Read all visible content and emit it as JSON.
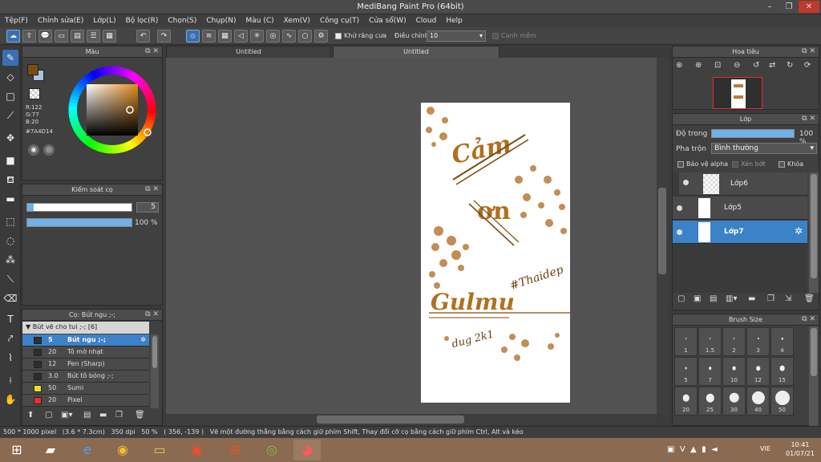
{
  "window": {
    "title": "MediBang Paint Pro (64bit)",
    "min": "–",
    "max": "❐",
    "close": "✕"
  },
  "menu": [
    "Tệp(F)",
    "Chỉnh sửa(E)",
    "Lớp(L)",
    "Bộ lọc(R)",
    "Chọn(S)",
    "Chụp(N)",
    "Màu (C)",
    "Xem(V)",
    "Công cụ(T)",
    "Cửa sổ(W)",
    "Cloud",
    "Help"
  ],
  "toolbar": {
    "antialias_label": "Khử răng cưa",
    "correction_label": "Điều chỉnh",
    "correction_value": "10",
    "edge_label": "Cạnh mềm"
  },
  "tabs": [
    "Untitled",
    "Untitled"
  ],
  "color_panel": {
    "title": "Màu",
    "r": "R:122",
    "g": "G:77",
    "b": "B:20",
    "hex": "#7A4D14",
    "fg_color": "#7A4D14",
    "bg_color": "#A8C4E0"
  },
  "brush_control": {
    "title": "Kiểm soát cọ",
    "size": "5",
    "opacity": "100 %",
    "opacity_fraction": 1.0
  },
  "brush_panel": {
    "title": "Cọ: Bút ngu ;-;",
    "group": "Bút vẽ cho tui ;-; [6]",
    "items": [
      {
        "size": "5",
        "name": "Bút ngu ;-;",
        "color": "#2e2e2e",
        "selected": true
      },
      {
        "size": "20",
        "name": "Tô mờ nhạt",
        "color": "#2e2e2e"
      },
      {
        "size": "12",
        "name": "Pen (Sharp)",
        "color": "#2e2e2e"
      },
      {
        "size": "3.0",
        "name": "Bút tô bóng ;-;",
        "color": "#2e2e2e"
      },
      {
        "size": "50",
        "name": "Sumi",
        "color": "#f0e020"
      },
      {
        "size": "20",
        "name": "Pixel",
        "color": "#e83030"
      }
    ]
  },
  "navigator": {
    "title": "Hoa tiêu"
  },
  "layer_panel": {
    "title": "Lớp",
    "opacity_label": "Độ trong",
    "opacity_value": "100 %",
    "opacity_fraction": 1.0,
    "blend_label": "Pha trộn",
    "blend_value": "Bình thường",
    "protect_alpha": "Bảo vệ alpha",
    "clipping": "Xén bớt",
    "lock": "Khóa",
    "layers": [
      {
        "name": "Lớp6",
        "selected": false
      },
      {
        "name": "Lớp5",
        "selected": false
      },
      {
        "name": "Lớp7",
        "selected": true
      }
    ]
  },
  "brush_size_panel": {
    "title": "Brush Size",
    "sizes": [
      "1",
      "1.5",
      "2",
      "3",
      "4",
      "5",
      "7",
      "10",
      "12",
      "15",
      "20",
      "25",
      "30",
      "40",
      "50"
    ]
  },
  "status": {
    "size": "500 * 1000 pixel",
    "physical": "(3.6 * 7.3cm)",
    "dpi": "350 dpi",
    "zoom": "50 %",
    "coords": "( 356, -139 )",
    "hint": "Vẽ một đường thẳng bằng cách giữ phím Shift, Thay đổi cỡ cọ bằng cách giữ phím Ctrl, Alt và kéo"
  },
  "taskbar": {
    "lang": "VIE",
    "time": "10:41",
    "date": "01/07/21"
  },
  "artwork_text": [
    "Cảm",
    "ơn",
    "Gulmu",
    "#Thaidep",
    "dug 2k1"
  ]
}
